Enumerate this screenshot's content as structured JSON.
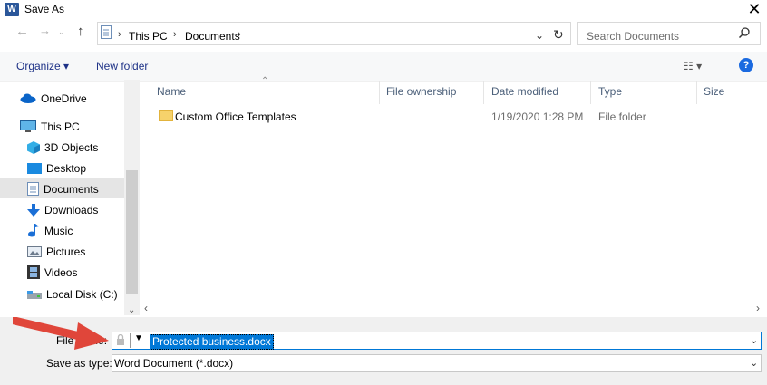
{
  "window": {
    "title": "Save As",
    "app_icon": "W",
    "close_label": "✕"
  },
  "address": {
    "crumbs": [
      "This PC",
      "Documents"
    ],
    "search_placeholder": "Search Documents"
  },
  "toolbar": {
    "organize_label": "Organize ▾",
    "new_folder_label": "New folder",
    "view_label": "☷ ▾",
    "help_label": "?"
  },
  "nav": {
    "items": [
      {
        "label": "OneDrive",
        "icon": "cloud-icon"
      },
      {
        "label": "This PC",
        "icon": "computer-icon"
      },
      {
        "label": "3D Objects",
        "icon": "cube-icon"
      },
      {
        "label": "Desktop",
        "icon": "desktop-icon"
      },
      {
        "label": "Documents",
        "icon": "document-icon"
      },
      {
        "label": "Downloads",
        "icon": "download-arrow-icon"
      },
      {
        "label": "Music",
        "icon": "music-note-icon"
      },
      {
        "label": "Pictures",
        "icon": "pictures-icon"
      },
      {
        "label": "Videos",
        "icon": "film-icon"
      },
      {
        "label": "Local Disk (C:)",
        "icon": "drive-icon"
      }
    ]
  },
  "columns": [
    "Name",
    "File ownership",
    "Date modified",
    "Type",
    "Size"
  ],
  "files": [
    {
      "name": "Custom Office Templates",
      "ownership": "",
      "date_modified": "1/19/2020 1:28 PM",
      "type": "File folder",
      "size": ""
    }
  ],
  "form": {
    "file_name_label": "File name:",
    "file_name_value": "Protected business.docx",
    "save_type_label": "Save as type:",
    "save_type_value": "Word Document (*.docx)"
  },
  "colors": {
    "accent": "#0078d7",
    "annotation_arrow": "#e0463a"
  }
}
